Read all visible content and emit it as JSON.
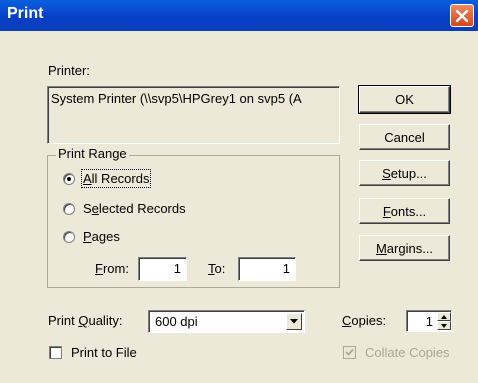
{
  "window": {
    "title": "Print",
    "close_icon": "close-x-icon",
    "close_color": "#d9441b",
    "titlebar_color": "#0a50d8"
  },
  "printer": {
    "label": "Printer:",
    "value": "System Printer (\\\\svp5\\HPGrey1 on svp5 (A"
  },
  "buttons": {
    "ok": "OK",
    "cancel": "Cancel",
    "setup": "Setup...",
    "fonts": "Fonts...",
    "margins": "Margins..."
  },
  "print_range": {
    "label": "Print Range",
    "options": [
      {
        "label": "All Records",
        "selected": true
      },
      {
        "label": "Selected Records",
        "selected": false
      },
      {
        "label": "Pages",
        "selected": false
      }
    ],
    "from_label": "From:",
    "from_value": "1",
    "to_label": "To:",
    "to_value": "1"
  },
  "quality": {
    "label": "Print Quality:",
    "value": "600 dpi",
    "arrow_icon": "dropdown-arrow-icon"
  },
  "print_to_file": {
    "label": "Print to File",
    "checked": false
  },
  "copies": {
    "label": "Copies:",
    "value": "1"
  },
  "collate": {
    "label": "Collate Copies",
    "checked": true,
    "enabled": false
  }
}
